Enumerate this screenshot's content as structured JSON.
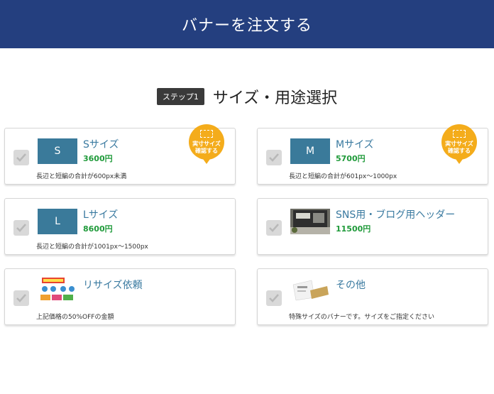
{
  "header": {
    "title": "バナーを注文する"
  },
  "step": {
    "badge": "ステップ1",
    "title": "サイズ・用途選択"
  },
  "cards": [
    {
      "thumb": "S",
      "title": "Sサイズ",
      "price": "3600円",
      "desc": "長辺と短編の合計が600px未満",
      "badge": "実寸サイズ確認する"
    },
    {
      "thumb": "M",
      "title": "Mサイズ",
      "price": "5700円",
      "desc": "長辺と短編の合計が601px〜1000px",
      "badge": "実寸サイズ確認する"
    },
    {
      "thumb": "L",
      "title": "Lサイズ",
      "price": "8600円",
      "desc": "長辺と短編の合計が1001px〜1500px"
    },
    {
      "thumb": "",
      "title": "SNS用・ブログ用ヘッダー",
      "price": "11500円",
      "desc": ""
    },
    {
      "thumb": "",
      "title": "リサイズ依頼",
      "price": "",
      "desc": "上記価格の50%OFFの金額"
    },
    {
      "thumb": "",
      "title": "その他",
      "price": "",
      "desc": "特殊サイズのバナーです。サイズをご指定ください"
    }
  ]
}
